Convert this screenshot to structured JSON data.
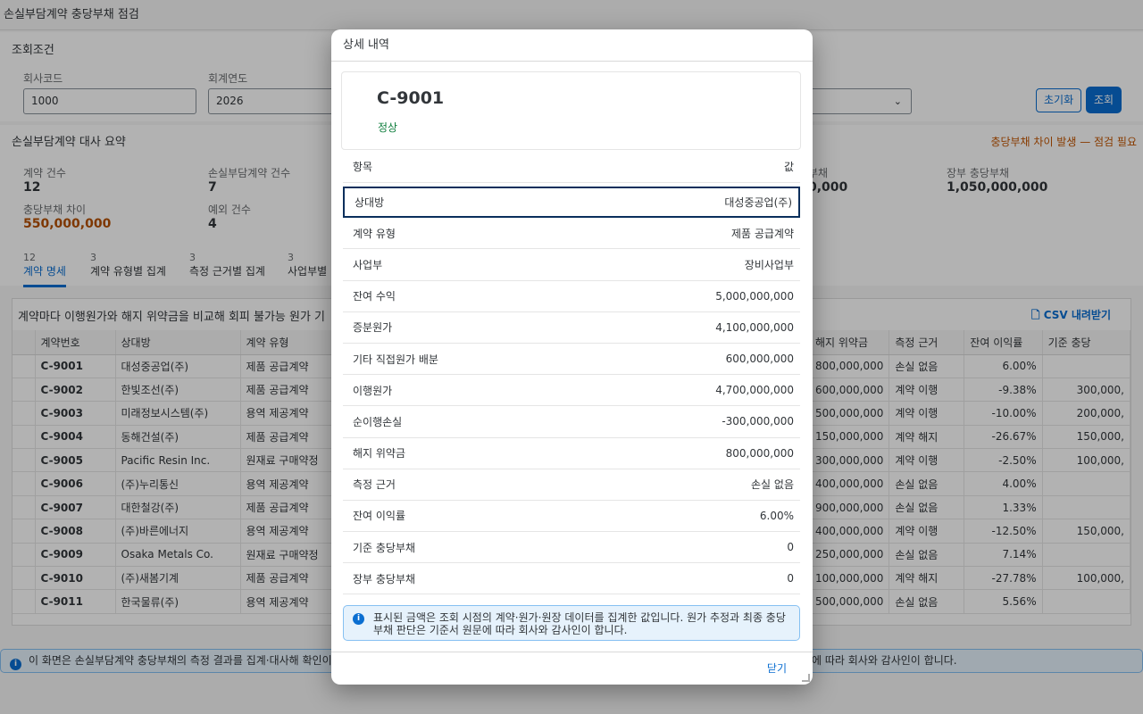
{
  "page": {
    "title": "손실부담계약 충당부채 점검"
  },
  "filter": {
    "section_title": "조회조건",
    "company_label": "회사코드",
    "company_value": "1000",
    "year_label": "회계연도",
    "year_value": "2026",
    "reset_label": "초기화",
    "search_label": "조회"
  },
  "summary": {
    "title": "손실부담계약 대사 요약",
    "warning": "충당부채 차이 발생 — 점검 필요",
    "kpis": {
      "contracts_label": "계약 건수",
      "contracts_value": "12",
      "onerous_label": "손실부담계약 건수",
      "onerous_value": "7",
      "diff_label": "충당부채 차이",
      "diff_value": "550,000,000",
      "exception_label": "예외 건수",
      "exception_value": "4",
      "partial_label": "부채",
      "partial_value": "0,000",
      "book_label": "장부 충당부채",
      "book_value": "1,050,000,000"
    }
  },
  "tabs": [
    {
      "count": "12",
      "label": "계약 명세"
    },
    {
      "count": "3",
      "label": "계약 유형별 집계"
    },
    {
      "count": "3",
      "label": "측정 근거별 집계"
    },
    {
      "count": "3",
      "label": "사업부별"
    }
  ],
  "table": {
    "caption": "계약마다 이행원가와 해지 위약금을 비교해 회피 불가능 원가 기",
    "csv_label": "CSV 내려받기",
    "left_headers": [
      "계약번호",
      "상대방",
      "계약 유형"
    ],
    "right_headers": [
      "해지 위약금",
      "측정 근거",
      "잔여 이익률",
      "기준 충당"
    ],
    "rows": [
      {
        "id": "C-9001",
        "party": "대성중공업(주)",
        "type": "제품 공급계약",
        "penalty": "800,000,000",
        "basis": "손실 없음",
        "margin": "6.00%",
        "prov": ""
      },
      {
        "id": "C-9002",
        "party": "한빛조선(주)",
        "type": "제품 공급계약",
        "penalty": "600,000,000",
        "basis": "계약 이행",
        "margin": "-9.38%",
        "prov": "300,000,"
      },
      {
        "id": "C-9003",
        "party": "미래정보시스템(주)",
        "type": "용역 제공계약",
        "penalty": "500,000,000",
        "basis": "계약 이행",
        "margin": "-10.00%",
        "prov": "200,000,"
      },
      {
        "id": "C-9004",
        "party": "동해건설(주)",
        "type": "제품 공급계약",
        "penalty": "150,000,000",
        "basis": "계약 해지",
        "margin": "-26.67%",
        "prov": "150,000,"
      },
      {
        "id": "C-9005",
        "party": "Pacific Resin Inc.",
        "type": "원재료 구매약정",
        "penalty": "300,000,000",
        "basis": "계약 이행",
        "margin": "-2.50%",
        "prov": "100,000,"
      },
      {
        "id": "C-9006",
        "party": "(주)누리통신",
        "type": "용역 제공계약",
        "penalty": "400,000,000",
        "basis": "손실 없음",
        "margin": "4.00%",
        "prov": ""
      },
      {
        "id": "C-9007",
        "party": "대한철강(주)",
        "type": "제품 공급계약",
        "penalty": "900,000,000",
        "basis": "손실 없음",
        "margin": "1.33%",
        "prov": ""
      },
      {
        "id": "C-9008",
        "party": "(주)바른에너지",
        "type": "용역 제공계약",
        "penalty": "400,000,000",
        "basis": "계약 이행",
        "margin": "-12.50%",
        "prov": "150,000,"
      },
      {
        "id": "C-9009",
        "party": "Osaka Metals Co.",
        "type": "원재료 구매약정",
        "penalty": "250,000,000",
        "basis": "손실 없음",
        "margin": "7.14%",
        "prov": ""
      },
      {
        "id": "C-9010",
        "party": "(주)새봄기계",
        "type": "제품 공급계약",
        "penalty": "100,000,000",
        "basis": "계약 해지",
        "margin": "-27.78%",
        "prov": "100,000,"
      },
      {
        "id": "C-9011",
        "party": "한국물류(주)",
        "type": "용역 제공계약",
        "penalty": "500,000,000",
        "basis": "손실 없음",
        "margin": "5.56%",
        "prov": ""
      }
    ]
  },
  "info_strip": {
    "left": "이 화면은 손실부담계약 충당부채의 측정 결과를 집계·대사해 확인이",
    "right": "에 따라 회사와 감사인이 합니다."
  },
  "dialog": {
    "title": "상세 내역",
    "object_title": "C-9001",
    "object_status": "정상",
    "col_item": "항목",
    "col_value": "값",
    "rows": [
      {
        "label": "상대방",
        "value": "대성중공업(주)"
      },
      {
        "label": "계약 유형",
        "value": "제품 공급계약"
      },
      {
        "label": "사업부",
        "value": "장비사업부"
      },
      {
        "label": "잔여 수익",
        "value": "5,000,000,000"
      },
      {
        "label": "증분원가",
        "value": "4,100,000,000"
      },
      {
        "label": "기타 직접원가 배분",
        "value": "600,000,000"
      },
      {
        "label": "이행원가",
        "value": "4,700,000,000"
      },
      {
        "label": "순이행손실",
        "value": "-300,000,000"
      },
      {
        "label": "해지 위약금",
        "value": "800,000,000"
      },
      {
        "label": "측정 근거",
        "value": "손실 없음"
      },
      {
        "label": "잔여 이익률",
        "value": "6.00%"
      },
      {
        "label": "기준 충당부채",
        "value": "0"
      },
      {
        "label": "장부 충당부채",
        "value": "0"
      }
    ],
    "message": "표시된 금액은 조회 시점의 계약·원가·원장 데이터를 집계한 값입니다. 원가 추정과 최종 충당부채 판단은 기준서 원문에 따라 회사와 감사인이 합니다.",
    "close_label": "닫기"
  }
}
